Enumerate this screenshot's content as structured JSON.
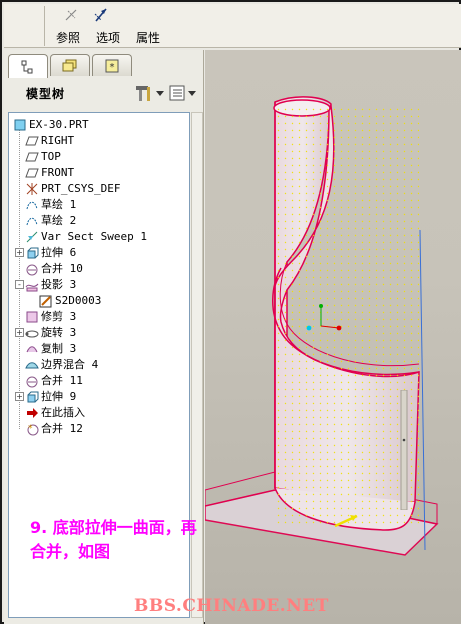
{
  "dashboard": {
    "tabs": [
      "参照",
      "选项",
      "属性"
    ]
  },
  "model_tree": {
    "title": "模型树",
    "items": [
      {
        "label": "EX-30.PRT",
        "icon": "part-icon",
        "expander": ""
      },
      {
        "label": "RIGHT",
        "icon": "datum-plane-icon",
        "expander": ""
      },
      {
        "label": "TOP",
        "icon": "datum-plane-icon",
        "expander": ""
      },
      {
        "label": "FRONT",
        "icon": "datum-plane-icon",
        "expander": ""
      },
      {
        "label": "PRT_CSYS_DEF",
        "icon": "csys-icon",
        "expander": ""
      },
      {
        "label": "草绘 1",
        "icon": "sketch-icon",
        "expander": ""
      },
      {
        "label": "草绘 2",
        "icon": "sketch-icon",
        "expander": ""
      },
      {
        "label": "Var Sect Sweep 1",
        "icon": "sweep-icon",
        "expander": ""
      },
      {
        "label": "拉伸 6",
        "icon": "extrude-icon",
        "expander": "+"
      },
      {
        "label": "合并 10",
        "icon": "merge-icon",
        "expander": ""
      },
      {
        "label": "投影 3",
        "icon": "project-icon",
        "expander": "-"
      },
      {
        "label": "S2D0003",
        "icon": "drawing-icon",
        "expander": ""
      },
      {
        "label": "修剪 3",
        "icon": "trim-icon",
        "expander": ""
      },
      {
        "label": "旋转 3",
        "icon": "revolve-icon",
        "expander": "+"
      },
      {
        "label": "复制 3",
        "icon": "copy-icon",
        "expander": ""
      },
      {
        "label": "边界混合 4",
        "icon": "boundary-blend-icon",
        "expander": ""
      },
      {
        "label": "合并 11",
        "icon": "merge-icon",
        "expander": ""
      },
      {
        "label": "拉伸 9",
        "icon": "extrude-icon",
        "expander": "+"
      },
      {
        "label": "在此插入",
        "icon": "insert-here-arrow-icon",
        "expander": ""
      },
      {
        "label": "合并 12",
        "icon": "merge-new-icon",
        "expander": ""
      }
    ]
  },
  "caption": {
    "line1": "9. 底部拉伸一曲面，再",
    "line2": "合并，如图"
  },
  "watermark": "BBS.CHINADE.NET",
  "colors": {
    "caption": "#ff00ff",
    "watermark": "#ff7f7f",
    "model_edge": "#e0004f",
    "mesh": "#f0e000",
    "viewport_bg": "#c9c5bb"
  }
}
